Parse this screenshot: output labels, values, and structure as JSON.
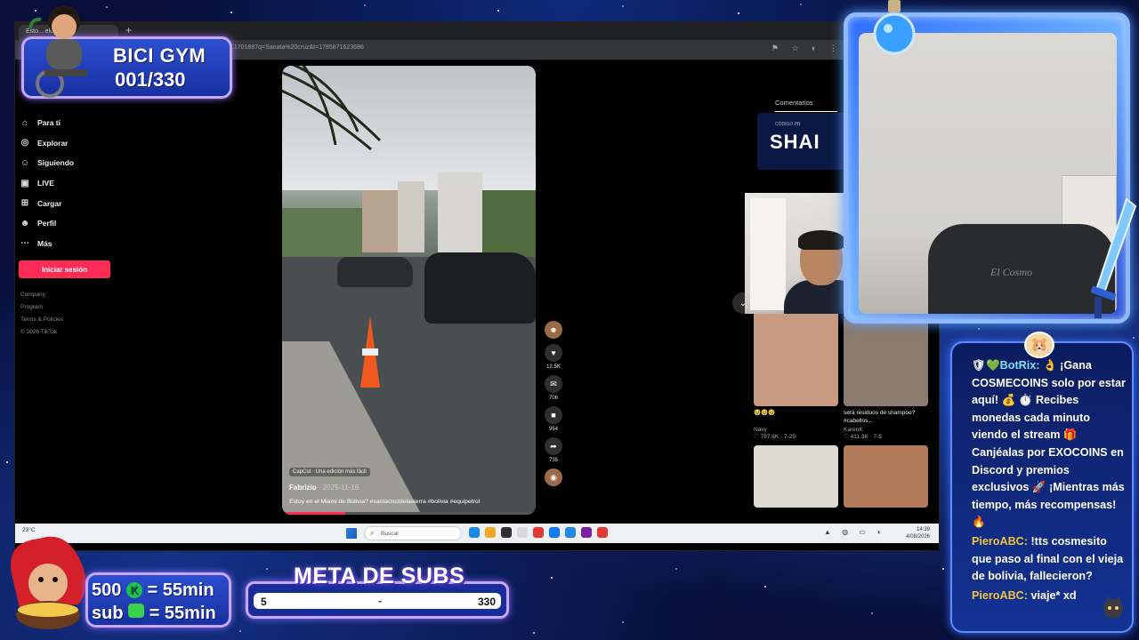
{
  "browser": {
    "tab_title": "Esto... ele? #sa...",
    "tab_plus": "+",
    "url": "...1701887q=Sanata%20cruz&t=1785871623686",
    "address_icons": "⚑ ☆ ◐ ⋮"
  },
  "sidebar": {
    "items": [
      {
        "icon": "home-icon",
        "glyph": "⌂",
        "label": "Para ti"
      },
      {
        "icon": "compass-icon",
        "glyph": "◎",
        "label": "Explorar"
      },
      {
        "icon": "users-icon",
        "glyph": "☺",
        "label": "Siguiendo"
      },
      {
        "icon": "live-icon",
        "glyph": "▣",
        "label": "LIVE"
      },
      {
        "icon": "upload-icon",
        "glyph": "⊞",
        "label": "Cargar"
      },
      {
        "icon": "user-icon",
        "glyph": "☻",
        "label": "Perfil"
      },
      {
        "icon": "more-icon",
        "glyph": "⋯",
        "label": "Más"
      }
    ],
    "login_button": "Iniciar sesión",
    "footer": [
      "Company",
      "Program",
      "Terms & Policies",
      "© 2026 TikTok"
    ]
  },
  "video": {
    "capcut_label": "CapCut · Una edición más fácil",
    "author": "Fabrizio",
    "date": " · 2025-11-16",
    "description": "Estoy en el Miami de Bolivia? #santacruzdelasierra #bolivia #equipetrol",
    "progress": 0.25,
    "actions": [
      {
        "icon": "heart-icon",
        "glyph": "♥",
        "count": "12.5K"
      },
      {
        "icon": "comment-icon",
        "glyph": "✉",
        "count": "706"
      },
      {
        "icon": "bookmark-icon",
        "glyph": "■",
        "count": "954"
      },
      {
        "icon": "share-icon",
        "glyph": "➦",
        "count": "735"
      }
    ]
  },
  "right_panel": {
    "comments_label": "Comentarios",
    "promo_small": "CÓDIGO PR",
    "promo_big": "SHAI",
    "thumbs": [
      {
        "title": "🥹🥹🥹",
        "meta": "Navy",
        "stats": "♡ 787.6K · 7-25",
        "color": "#c99a82"
      },
      {
        "title": "será residuos de shampoo? #cabellos...",
        "meta": "KarenK",
        "stats": "♡ 411.3K · 7-5",
        "color": "#8b7a6e"
      }
    ],
    "thumbs_row2": [
      {
        "color": "#ddd8d0"
      },
      {
        "color": "#b07a5a"
      }
    ]
  },
  "taskbar": {
    "weather": "23°C",
    "search_placeholder": "Buscar",
    "tray_icons": "▲ ◍ ▭ ◖",
    "time": "14:39",
    "date": "4/08/2026",
    "apps": [
      "#1e88e5",
      "#f5a623",
      "#2f2f2f",
      "#d9d9d9",
      "#e53935",
      "#0a7cff",
      "#1e88e5",
      "#7b1fa2",
      "#e53935"
    ]
  },
  "overlay": {
    "gym_title": "BICI GYM",
    "gym_count": "001/330",
    "subs_line1_left": "500",
    "subs_line1_right": "= 55min",
    "subs_line2_left": "sub",
    "subs_line2_right": "= 55min",
    "meta_title": "META DE SUBS",
    "meta_start": "5",
    "meta_mid": "-",
    "meta_end": "330",
    "meta_progress": 0.015,
    "cam_chair_label": "El Cosmo"
  },
  "chat": {
    "messages": [
      {
        "user": "BotRix:",
        "bot": true,
        "text": "👌 ¡Gana COSMECOINS solo por estar aquí! 💰 ⏱️ Recibes monedas cada minuto viendo el stream 🎁 Canjéalas por EXOCOINS en Discord y premios exclusivos 🚀 ¡Mientras más tiempo, más recompensas! 🔥"
      },
      {
        "user": "PieroABC:",
        "bot": false,
        "text": "!tts cosmesito que paso al final con el vieja de bolivia, fallecieron?"
      },
      {
        "user": "PieroABC:",
        "bot": false,
        "text": "viaje* xd"
      }
    ],
    "badge_prefix": "🛡💚"
  },
  "colors": {
    "tiktok_red": "#fe2c55",
    "overlay_border": "#c6a8ff",
    "chat_name": "#f3c242",
    "bot_name": "#7ee0ff"
  }
}
